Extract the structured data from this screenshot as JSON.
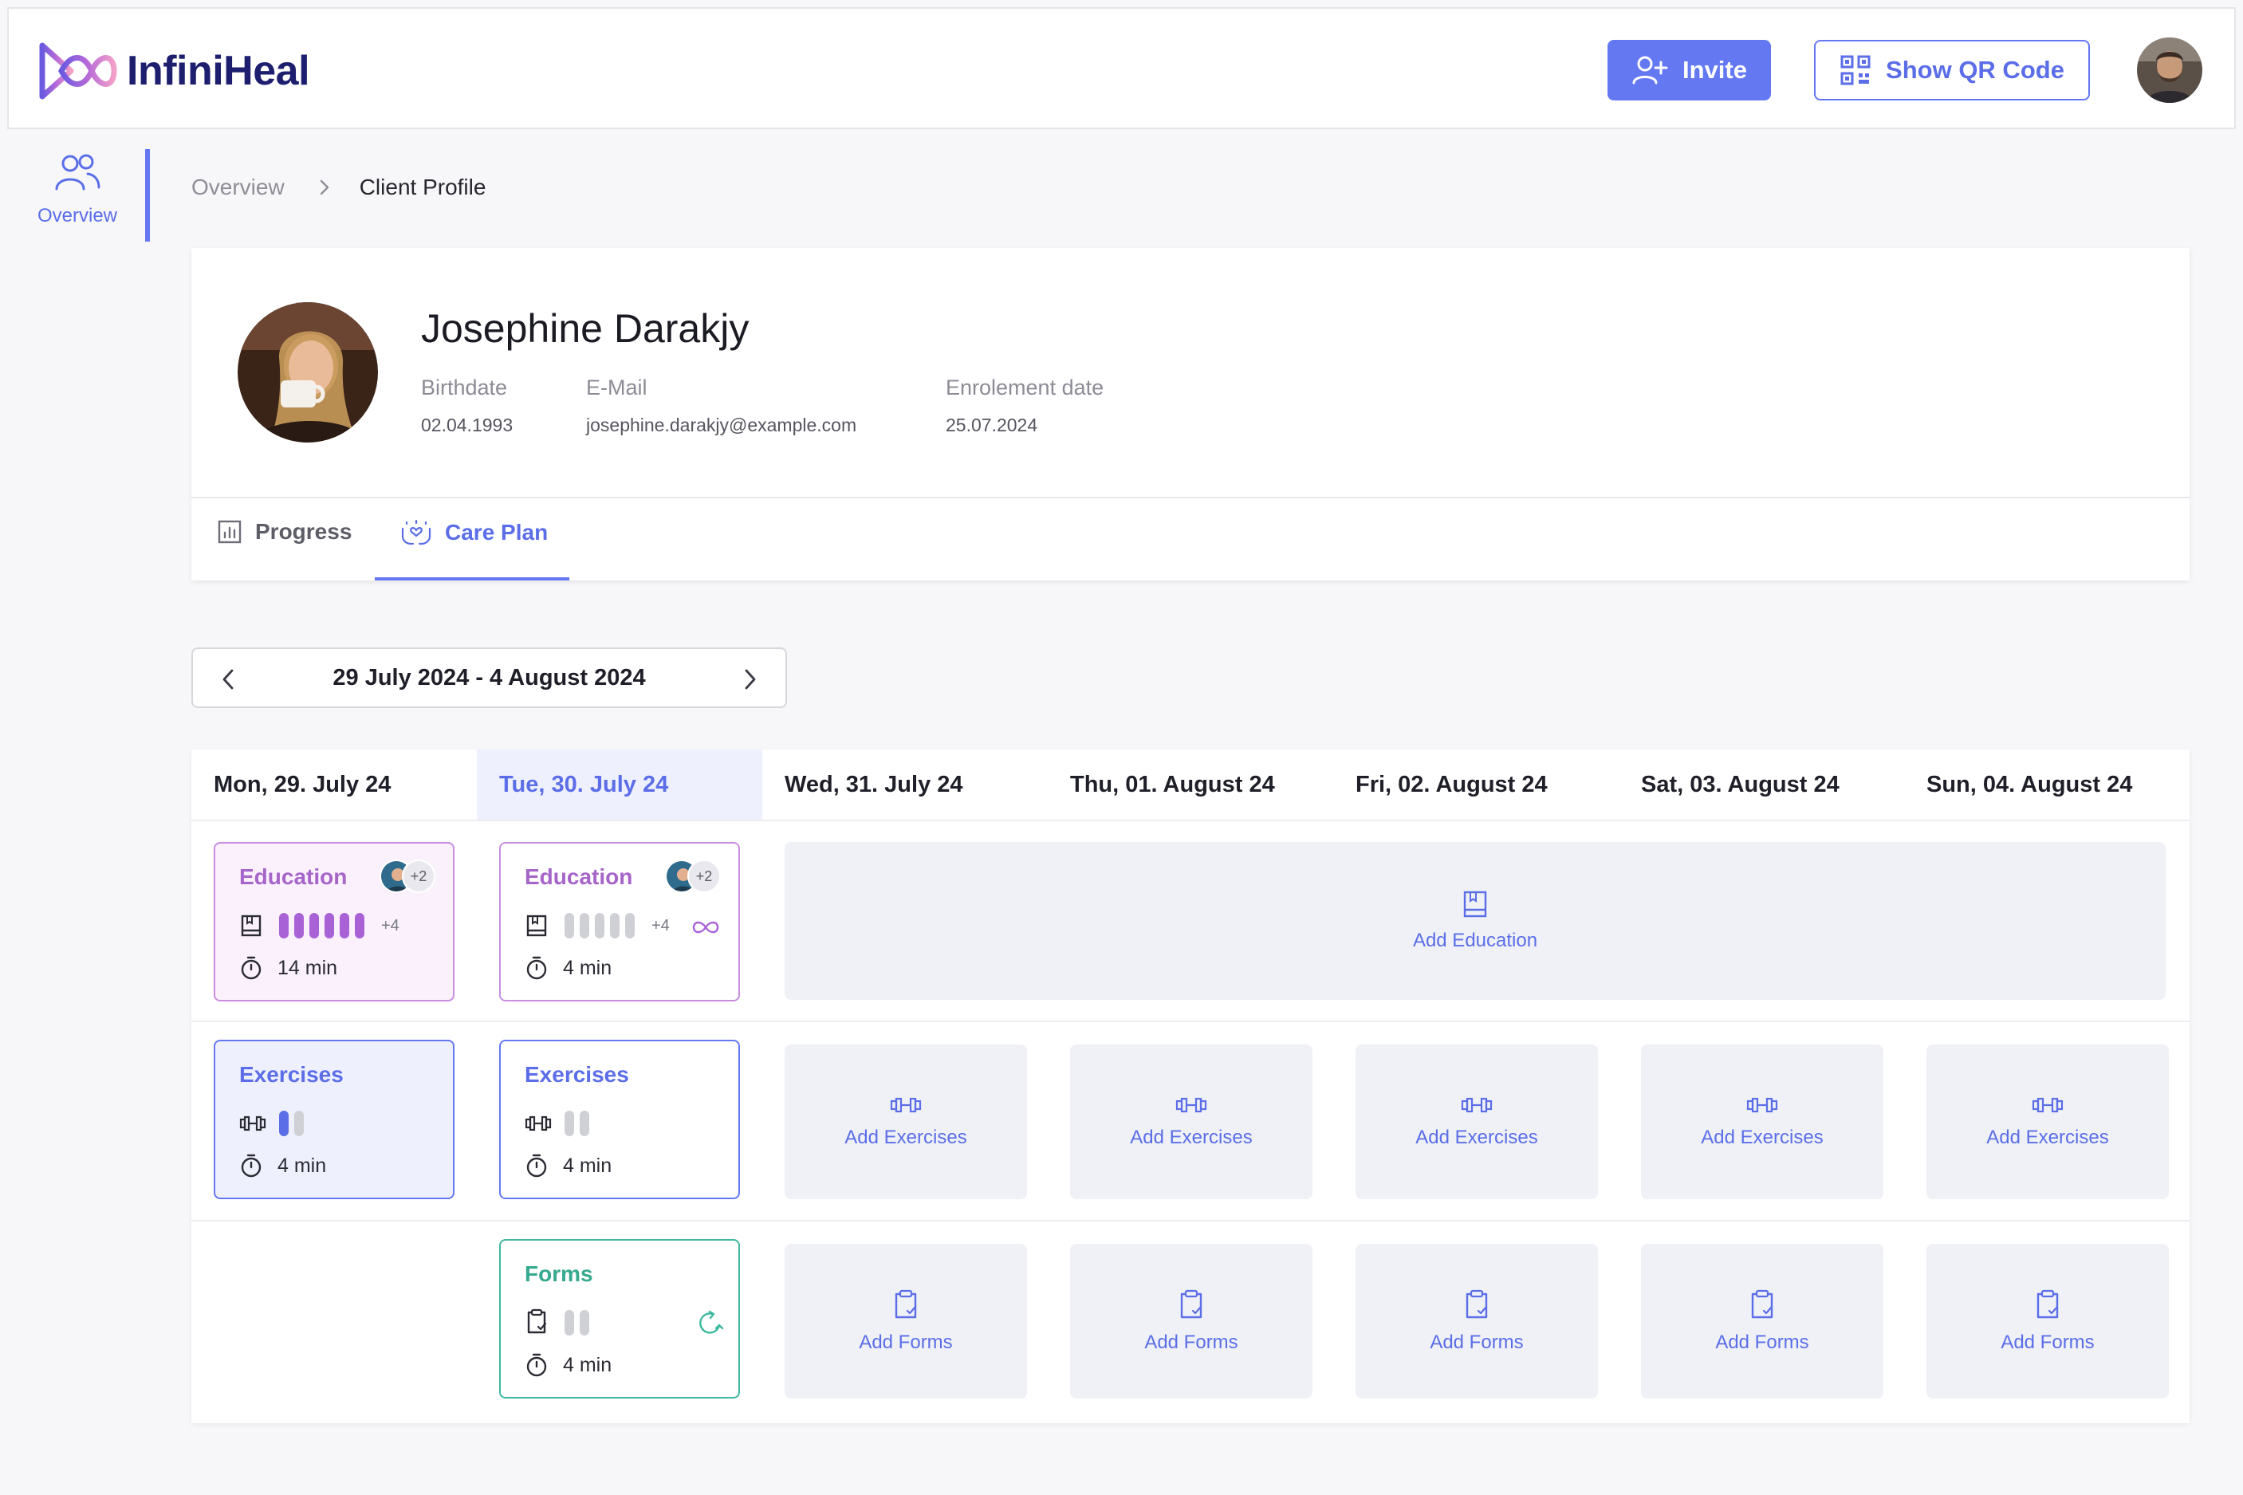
{
  "app": {
    "name": "InfiniHeal"
  },
  "header": {
    "invite_label": "Invite",
    "qr_label": "Show QR Code"
  },
  "sidenav": {
    "items": [
      {
        "label": "Overview",
        "icon": "users-icon"
      }
    ]
  },
  "breadcrumb": {
    "parent": "Overview",
    "current": "Client Profile"
  },
  "client": {
    "name": "Josephine Darakjy",
    "birthdate_label": "Birthdate",
    "birthdate": "02.04.1993",
    "email_label": "E-Mail",
    "email": "josephine.darakjy@example.com",
    "enrolment_label": "Enrolement date",
    "enrolment_date": "25.07.2024"
  },
  "tabs": [
    {
      "label": "Progress",
      "icon": "chart-icon",
      "active": false
    },
    {
      "label": "Care Plan",
      "icon": "hands-heart-icon",
      "active": true
    }
  ],
  "week": {
    "range": "29 July 2024 - 4 August 2024"
  },
  "days": [
    {
      "label": "Mon, 29. July 24",
      "today": false
    },
    {
      "label": "Tue, 30. July 24",
      "today": true
    },
    {
      "label": "Wed, 31. July 24",
      "today": false
    },
    {
      "label": "Thu, 01. August 24",
      "today": false
    },
    {
      "label": "Fri, 02. August 24",
      "today": false
    },
    {
      "label": "Sat, 03. August 24",
      "today": false
    },
    {
      "label": "Sun, 04. August 24",
      "today": false
    }
  ],
  "plan": {
    "mon": {
      "education": {
        "title": "Education",
        "avatars_extra": "+2",
        "more": "+4",
        "time": "14 min"
      },
      "exercises": {
        "title": "Exercises",
        "time": "4 min"
      }
    },
    "tue": {
      "education": {
        "title": "Education",
        "avatars_extra": "+2",
        "more": "+4",
        "time": "4 min"
      },
      "exercises": {
        "title": "Exercises",
        "time": "4 min"
      },
      "forms": {
        "title": "Forms",
        "time": "4 min"
      }
    },
    "add_education": "Add Education",
    "add_exercises": "Add Exercises",
    "add_forms": "Add Forms"
  },
  "colors": {
    "primary": "#6478f2",
    "education": "#a962d6",
    "forms": "#3fb8a0",
    "add_bg": "#eff1f6"
  }
}
